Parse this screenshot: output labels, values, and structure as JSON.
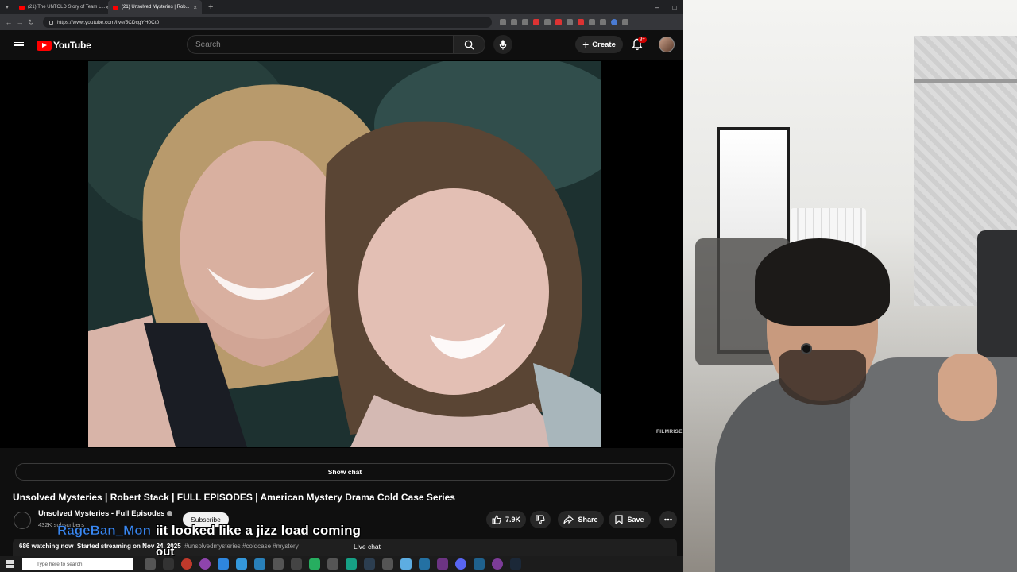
{
  "browser": {
    "tabs": [
      {
        "title": "(21) The UNTOLD Story of Team L...",
        "active": false
      },
      {
        "title": "(21) Unsolved Mysteries | Rob...",
        "active": true
      }
    ],
    "url": "https://www.youtube.com/live/5CDcgYH0Ct0"
  },
  "youtube": {
    "logo_text": "YouTube",
    "search_placeholder": "Search",
    "create_label": "Create",
    "notifications_badge": "9+"
  },
  "player": {
    "watermark": "FILMRISE"
  },
  "video": {
    "show_chat_label": "Show chat",
    "title": "Unsolved Mysteries | Robert Stack | FULL EPISODES | American Mystery Drama Cold Case Series",
    "channel_name": "Unsolved Mysteries - Full Episodes",
    "subscribers": "432K subscribers",
    "subscribe_label": "Subscribe",
    "likes": "7.9K",
    "share_label": "Share",
    "save_label": "Save",
    "watching": "686 watching now",
    "started": "Started streaming on Nov 24, 2025",
    "tags": "#unsolvedmysteries #coldcase #mystery",
    "live_chat_label": "Live chat"
  },
  "stream_overlay": {
    "username": "RageBan_Mon",
    "message": "iit looked like a jizz load coming",
    "message_cont": "out"
  },
  "taskbar": {
    "search_placeholder": "Type here to search"
  },
  "colors": {
    "youtube_red": "#ff0000",
    "overlay_username": "#3a87f0",
    "background": "#0f0f0f"
  }
}
